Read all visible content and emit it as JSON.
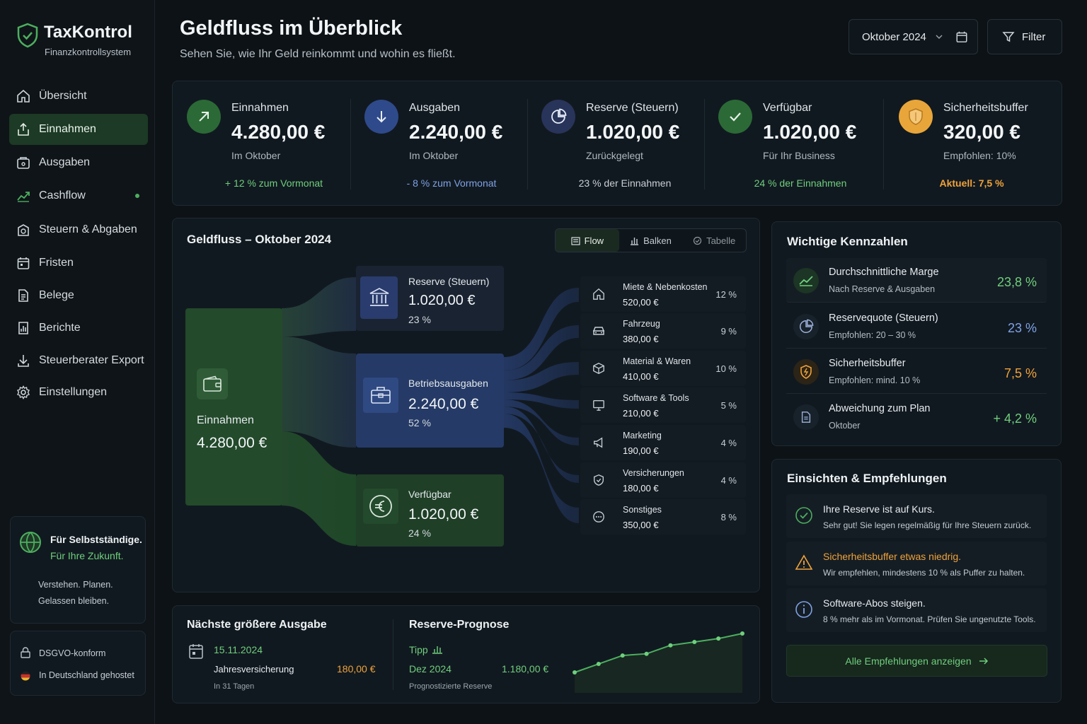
{
  "brand": {
    "name": "TaxKontrol",
    "tagline": "Finanzkontrollsystem"
  },
  "nav": [
    {
      "label": "Übersicht",
      "icon": "home-icon"
    },
    {
      "label": "Einnahmen",
      "icon": "money-bag-icon"
    },
    {
      "label": "Ausgaben",
      "icon": "wallet-icon"
    },
    {
      "label": "Cashflow",
      "icon": "trend-icon"
    },
    {
      "label": "Steuern & Abgaben",
      "icon": "bank-icon"
    },
    {
      "label": "Fristen",
      "icon": "calendar-icon"
    },
    {
      "label": "Belege",
      "icon": "document-icon"
    },
    {
      "label": "Berichte",
      "icon": "report-icon"
    },
    {
      "label": "Steuerberater Export",
      "icon": "download-icon"
    },
    {
      "label": "Einstellungen",
      "icon": "gear-icon"
    }
  ],
  "promo": {
    "title": "Für Selbstständige.",
    "highlight": "Für Ihre Zukunft.",
    "line1": "Verstehen. Planen.",
    "line2": "Gelassen bleiben."
  },
  "trust": {
    "gdpr": "DSGVO-konform",
    "hosting": "In Deutschland gehostet"
  },
  "header": {
    "title": "Geldfluss im Überblick",
    "subtitle": "Sehen Sie, wie Ihr Geld reinkommt und wohin es fließt.",
    "period": "Oktober 2024",
    "filter": "Filter"
  },
  "kpis": [
    {
      "label": "Einnahmen",
      "value": "4.280,00 €",
      "sub": "Im Oktober",
      "foot": "+ 12 % zum Vormonat",
      "color": "#6fcf7d"
    },
    {
      "label": "Ausgaben",
      "value": "2.240,00 €",
      "sub": "Im Oktober",
      "foot": "- 8 % zum Vormonat",
      "color": "#7ea2e6"
    },
    {
      "label": "Reserve (Steuern)",
      "value": "1.020,00 €",
      "sub": "Zurückgelegt",
      "foot": "23 % der Einnahmen",
      "color": "#c9d0d5"
    },
    {
      "label": "Verfügbar",
      "value": "1.020,00 €",
      "sub": "Für Ihr Business",
      "foot": "24 % der Einnahmen",
      "color": "#6fcf7d"
    },
    {
      "label": "Sicherheitsbuffer",
      "value": "320,00 €",
      "sub": "Empfohlen: 10%",
      "foot": "Aktuell: 7,5 %",
      "color": "#f0a33a"
    }
  ],
  "flow": {
    "title": "Geldfluss – Oktober 2024",
    "tabs": [
      "Flow",
      "Balken",
      "Tabelle"
    ],
    "income": {
      "label": "Einnahmen",
      "value": "4.280,00 €"
    },
    "reserve": {
      "label": "Reserve (Steuern)",
      "value": "1.020,00 €",
      "pct": "23 %"
    },
    "expenses": {
      "label": "Betriebsausgaben",
      "value": "2.240,00 €",
      "pct": "52 %"
    },
    "available": {
      "label": "Verfügbar",
      "value": "1.020,00 €",
      "pct": "24 %"
    },
    "items": [
      {
        "name": "Miete & Nebenkosten",
        "value": "520,00 €",
        "pct": "12 %",
        "icon": "home-icon"
      },
      {
        "name": "Fahrzeug",
        "value": "380,00 €",
        "pct": "9 %",
        "icon": "car-icon"
      },
      {
        "name": "Material & Waren",
        "value": "410,00 €",
        "pct": "10 %",
        "icon": "box-icon"
      },
      {
        "name": "Software & Tools",
        "value": "210,00 €",
        "pct": "5 %",
        "icon": "monitor-icon"
      },
      {
        "name": "Marketing",
        "value": "190,00 €",
        "pct": "4 %",
        "icon": "megaphone-icon"
      },
      {
        "name": "Versicherungen",
        "value": "180,00 €",
        "pct": "4 %",
        "icon": "shield-icon"
      },
      {
        "name": "Sonstiges",
        "value": "350,00 €",
        "pct": "8 %",
        "icon": "more-icon"
      }
    ]
  },
  "next_expense": {
    "title": "Nächste größere Ausgabe",
    "date": "15.11.2024",
    "name": "Jahresversicherung",
    "amount": "180,00 €",
    "in": "In 31 Tagen"
  },
  "forecast": {
    "title": "Reserve-Prognose",
    "tip": "Tipp",
    "month": "Dez 2024",
    "amount": "1.180,00 €",
    "caption": "Prognostizierte Reserve",
    "trend": [
      0,
      10,
      20,
      22,
      32,
      36,
      40,
      46
    ]
  },
  "kennzahlen": {
    "title": "Wichtige Kennzahlen",
    "items": [
      {
        "name": "Durchschnittliche Marge",
        "sub": "Nach Reserve & Ausgaben",
        "value": "23,8 %",
        "color": "#6fcf7d",
        "icon": "trend-icon"
      },
      {
        "name": "Reservequote (Steuern)",
        "sub": "Empfohlen: 20 – 30 %",
        "value": "23 %",
        "color": "#7ea2e6",
        "icon": "pie-icon"
      },
      {
        "name": "Sicherheitsbuffer",
        "sub": "Empfohlen: mind. 10 %",
        "value": "7,5 %",
        "color": "#f0a33a",
        "icon": "shield-icon"
      },
      {
        "name": "Abweichung zum Plan",
        "sub": "Oktober",
        "value": "+ 4,2 %",
        "color": "#6fcf7d",
        "icon": "document-icon"
      }
    ]
  },
  "insights": {
    "title": "Einsichten & Empfehlungen",
    "items": [
      {
        "title": "Ihre Reserve ist auf Kurs.",
        "text": "Sehr gut! Sie legen regelmäßig für Ihre Steuern zurück.",
        "color": "#e7ecef",
        "icon": "check-circle-icon"
      },
      {
        "title": "Sicherheitsbuffer etwas niedrig.",
        "text": "Wir empfehlen, mindestens 10 % als Puffer zu halten.",
        "color": "#f0a33a",
        "icon": "warning-icon"
      },
      {
        "title": "Software-Abos steigen.",
        "text": "8 % mehr als im Vormonat. Prüfen Sie ungenutzte Tools.",
        "color": "#e7ecef",
        "icon": "info-icon"
      }
    ],
    "cta": "Alle Empfehlungen anzeigen"
  }
}
